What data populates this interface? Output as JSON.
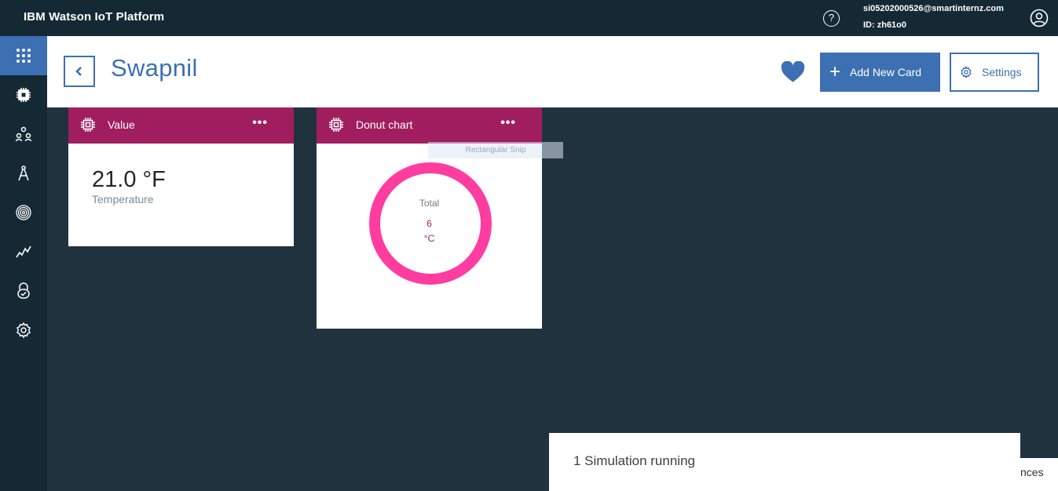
{
  "app": {
    "title": "IBM Watson IoT Platform"
  },
  "user": {
    "email": "si05202000526@smartinternz.com",
    "id": "ID: zh61o0"
  },
  "topbar": {
    "help_glyph": "?"
  },
  "sidebar": {
    "items": [
      {
        "icon": "apps-grid-icon",
        "active": true
      },
      {
        "icon": "device-chip-icon"
      },
      {
        "icon": "members-icon"
      },
      {
        "icon": "apps-compass-icon"
      },
      {
        "icon": "fingerprint-icon"
      },
      {
        "icon": "analytics-icon"
      },
      {
        "icon": "security-lock-icon"
      },
      {
        "icon": "settings-gear-icon"
      }
    ]
  },
  "header": {
    "title": "Swapnil",
    "add_card_label": "Add New Card",
    "add_card_plus": "+",
    "settings_label": "Settings"
  },
  "cards": {
    "value": {
      "title": "Value",
      "menu": "•••",
      "reading": "21.0 °F",
      "label": "Temperature"
    },
    "donut": {
      "title": "Donut chart",
      "menu": "•••",
      "total_label": "Total",
      "value": "6",
      "unit": "°C"
    }
  },
  "overlay": {
    "snip_text": "Rectangular Snip"
  },
  "toast": {
    "text": "1 Simulation running"
  },
  "partial_panel": {
    "text": "nces"
  },
  "colors": {
    "accent": "#3d70b2",
    "card_header": "#a01e60",
    "donut_ring": "#ff3ca0",
    "background": "#20323e",
    "topbar": "#152935"
  }
}
